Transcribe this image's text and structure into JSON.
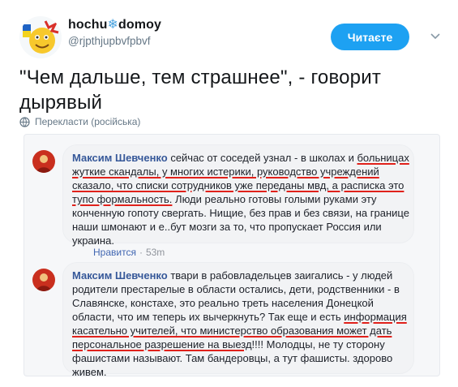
{
  "tweet": {
    "display_name_left": "hochu",
    "display_name_snow": "❄",
    "display_name_right": "domoy",
    "handle": "@rjpthjupbvfpbvf",
    "follow_label": "Читаєте",
    "text": "\"Чем дальше, тем страшнее\", - говорит дырявый",
    "translate_label": "Перекласти (російська)"
  },
  "comments": [
    {
      "author": "Максим Шевченко",
      "parts": [
        {
          "t": " сейчас от соседей узнал - в школах и ",
          "u": false
        },
        {
          "t": "больницах жуткие скандалы, у многих истерики, руководство учреждений сказало, что списки сотрудников уже переданы мвд, а расписка это тупо формальность.",
          "u": true
        },
        {
          "t": " Люди реально готовы голыми руками эту конченную гопоту свергать. Нищие, без прав и без связи, на границе наши шмонают и е..бут мозги за то, что пропускает Россия или украина.",
          "u": false
        }
      ],
      "like_label": "Нравится",
      "separator": "·",
      "time": "53m"
    },
    {
      "author": "Максим Шевченко",
      "parts": [
        {
          "t": " твари в рабовладельцев заигались - у людей родители престарелые в области остались, дети, родственники - в Славянске, констахе, это реально треть населения Донецкой области, что им теперь их вычеркнуть? Так еще и есть ",
          "u": false
        },
        {
          "t": "информация касательно учителей, что министерство образования может дать персональное разрешение на выезд",
          "u": true
        },
        {
          "t": "!!!! Молодцы, не ту сторону фашистами называют. Там бандеровцы, а тут фашисты. здорово живем.",
          "u": false
        }
      ]
    }
  ],
  "colors": {
    "accent": "#1da1f2",
    "fb_link": "#365899",
    "underline": "#e0211b",
    "muted": "#657786"
  }
}
